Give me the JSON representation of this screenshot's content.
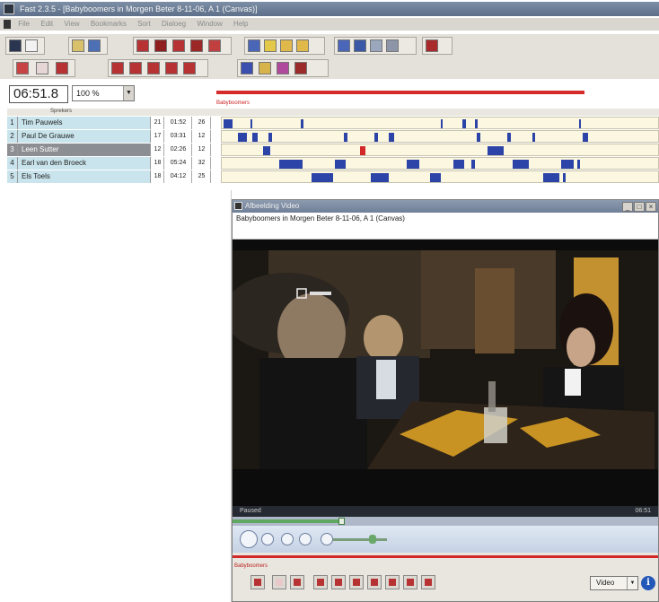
{
  "window": {
    "title": "Fast 2.3.5 - [Babyboomers in Morgen Beter 8-11-06, A 1 (Canvas)]"
  },
  "menu": [
    "File",
    "Edit",
    "View",
    "Bookmarks",
    "Sort",
    "Dialoeg",
    "Window",
    "Help"
  ],
  "timeline": {
    "timecode": "06:51.8",
    "zoom": "100 %",
    "red_label": "Babyboomers",
    "header_label": "Sprekers",
    "rows": [
      {
        "num": "1",
        "name": "Tim Pauwels",
        "a": "21",
        "b": "01:52",
        "c": "26"
      },
      {
        "num": "2",
        "name": "Paul De Grauwe",
        "a": "17",
        "b": "03:31",
        "c": "12"
      },
      {
        "num": "3",
        "name": "Leen Sutter",
        "a": "12",
        "b": "02:26",
        "c": "12"
      },
      {
        "num": "4",
        "name": "Earl van den Broeck",
        "a": "18",
        "b": "05:24",
        "c": "32"
      },
      {
        "num": "5",
        "name": "Els Toels",
        "a": "18",
        "b": "04:12",
        "c": "25"
      }
    ]
  },
  "video_window": {
    "title": "Afbeelding Video",
    "subtitle": "Babyboomers in Morgen Beter 8-11-06, A 1 (Canvas)",
    "status": "Paused",
    "time": "06:51",
    "red_label": "Babyboomers",
    "select_value": "Video",
    "info_glyph": "i"
  },
  "colors": {
    "accent_red": "#d22828",
    "segment_blue": "#2c44a8",
    "row_highlight": "#c9e4ec"
  }
}
